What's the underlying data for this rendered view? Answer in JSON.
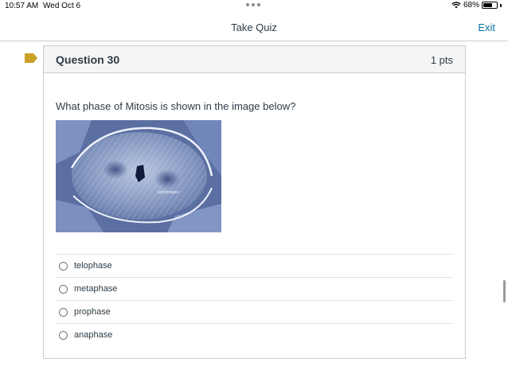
{
  "status_bar": {
    "time": "10:57 AM",
    "date": "Wed Oct 6",
    "battery": "68%",
    "battery_level": 0.68,
    "wifi_icon": "wifi-icon",
    "battery_icon": "battery-icon"
  },
  "nav": {
    "title": "Take Quiz",
    "exit_label": "Exit"
  },
  "question": {
    "flag_icon": "flag-icon",
    "flag_color": "#c9a227",
    "title": "Question 30",
    "points": "1 pts",
    "text": "What phase of Mitosis is shown in the image below?",
    "image_watermark": "gettyimages",
    "answers": [
      {
        "label": "telophase",
        "selected": false
      },
      {
        "label": "metaphase",
        "selected": false
      },
      {
        "label": "prophase",
        "selected": false
      },
      {
        "label": "anaphase",
        "selected": false
      }
    ]
  },
  "colors": {
    "link": "#0770a3",
    "text": "#2d3b45",
    "header_bg": "#f5f5f5",
    "border": "#c7cdd1"
  }
}
